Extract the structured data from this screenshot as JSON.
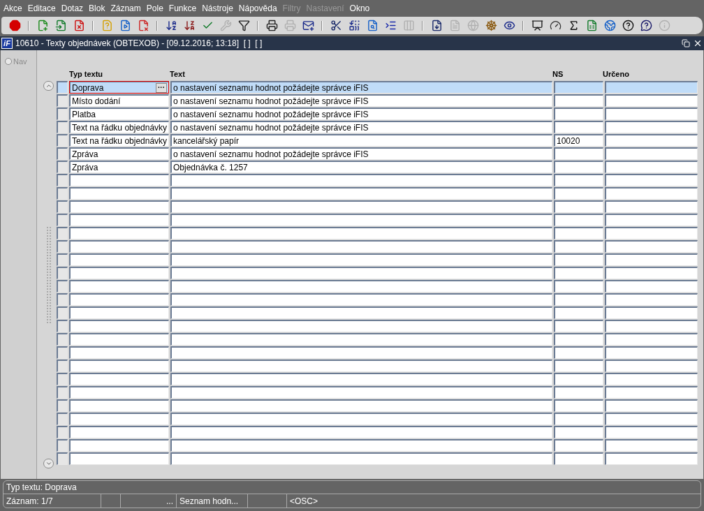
{
  "menu": [
    {
      "label": "Akce",
      "disabled": false
    },
    {
      "label": "Editace",
      "disabled": false
    },
    {
      "label": "Dotaz",
      "disabled": false
    },
    {
      "label": "Blok",
      "disabled": false
    },
    {
      "label": "Záznam",
      "disabled": false
    },
    {
      "label": "Pole",
      "disabled": false
    },
    {
      "label": "Funkce",
      "disabled": false
    },
    {
      "label": "Nástroje",
      "disabled": false
    },
    {
      "label": "Nápověda",
      "disabled": false
    },
    {
      "label": "Filtry",
      "disabled": true
    },
    {
      "label": "Nastavení",
      "disabled": true
    },
    {
      "label": "Okno",
      "disabled": false
    }
  ],
  "toolbar": [
    {
      "kind": "button",
      "disabled": false
    },
    {
      "kind": "separator"
    },
    {
      "kind": "button",
      "disabled": false
    },
    {
      "kind": "button",
      "disabled": false
    },
    {
      "kind": "button",
      "disabled": false
    },
    {
      "kind": "separator"
    },
    {
      "kind": "button",
      "disabled": false
    },
    {
      "kind": "button",
      "disabled": false
    },
    {
      "kind": "button",
      "disabled": false
    },
    {
      "kind": "separator"
    },
    {
      "kind": "button",
      "disabled": false
    },
    {
      "kind": "button",
      "disabled": false
    },
    {
      "kind": "button",
      "disabled": false
    },
    {
      "kind": "button",
      "disabled": true
    },
    {
      "kind": "button",
      "disabled": false
    },
    {
      "kind": "separator"
    },
    {
      "kind": "button",
      "disabled": false
    },
    {
      "kind": "button",
      "disabled": true
    },
    {
      "kind": "button",
      "disabled": false
    },
    {
      "kind": "separator"
    },
    {
      "kind": "button",
      "disabled": false
    },
    {
      "kind": "button",
      "disabled": false
    },
    {
      "kind": "button",
      "disabled": false
    },
    {
      "kind": "button",
      "disabled": false
    },
    {
      "kind": "button",
      "disabled": true
    },
    {
      "kind": "separator"
    },
    {
      "kind": "button",
      "disabled": false
    },
    {
      "kind": "button",
      "disabled": true
    },
    {
      "kind": "button",
      "disabled": true
    },
    {
      "kind": "button",
      "disabled": false
    },
    {
      "kind": "button",
      "disabled": false
    },
    {
      "kind": "separator"
    },
    {
      "kind": "button",
      "disabled": false
    },
    {
      "kind": "button",
      "disabled": false
    },
    {
      "kind": "button",
      "disabled": false
    },
    {
      "kind": "button",
      "disabled": false
    },
    {
      "kind": "button",
      "disabled": false
    },
    {
      "kind": "button",
      "disabled": false
    },
    {
      "kind": "button",
      "disabled": false
    },
    {
      "kind": "button",
      "disabled": true
    }
  ],
  "window": {
    "logo": "iF",
    "title": "10610 - Texty objednávek (OBTEXOB) - [09.12.2016; 13:18]  [ ]  [ ]"
  },
  "nav": {
    "label": "Nav",
    "selected": false
  },
  "table": {
    "columns": [
      "Typ textu",
      "Text",
      "NS",
      "Určeno"
    ],
    "rows": [
      {
        "selected": true,
        "focused": true,
        "button": "···",
        "typ": "Doprava",
        "text": "o nastavení seznamu hodnot požádejte správce iFIS"
      },
      {
        "selected": false,
        "typ": "Místo dodání",
        "text": "o nastavení seznamu hodnot požádejte správce iFIS"
      },
      {
        "selected": false,
        "typ": "Platba",
        "text": "o nastavení seznamu hodnot požádejte správce iFIS"
      },
      {
        "selected": false,
        "typ": "Text na řádku objednávky",
        "text": "o nastavení seznamu hodnot požádejte správce iFIS"
      },
      {
        "selected": false,
        "typ": "Text na řádku objednávky",
        "text": "kancelářský papír",
        "ns": "10020"
      },
      {
        "selected": false,
        "typ": "Zpráva",
        "text": "o nastavení seznamu hodnot požádejte správce iFIS"
      },
      {
        "selected": false,
        "typ": "Zpráva",
        "text": "Objednávka č. 1257"
      },
      {
        "selected": false
      },
      {
        "selected": false
      },
      {
        "selected": false
      },
      {
        "selected": false
      },
      {
        "selected": false
      },
      {
        "selected": false
      },
      {
        "selected": false
      },
      {
        "selected": false
      },
      {
        "selected": false
      },
      {
        "selected": false
      },
      {
        "selected": false
      },
      {
        "selected": false
      },
      {
        "selected": false
      },
      {
        "selected": false
      },
      {
        "selected": false
      },
      {
        "selected": false
      },
      {
        "selected": false
      },
      {
        "selected": false
      },
      {
        "selected": false
      },
      {
        "selected": false
      },
      {
        "selected": false
      },
      {
        "selected": false
      }
    ]
  },
  "status_bar": {
    "hint": "Typ textu: Doprava",
    "fields": [
      {
        "kind": "text",
        "text": "Záznam: 1/7"
      },
      {
        "kind": "blank"
      },
      {
        "kind": "text",
        "text": "..."
      },
      {
        "kind": "text",
        "text": "Seznam hodn..."
      },
      {
        "kind": "blank"
      },
      {
        "kind": "text",
        "text": "<OSC>"
      }
    ]
  }
}
